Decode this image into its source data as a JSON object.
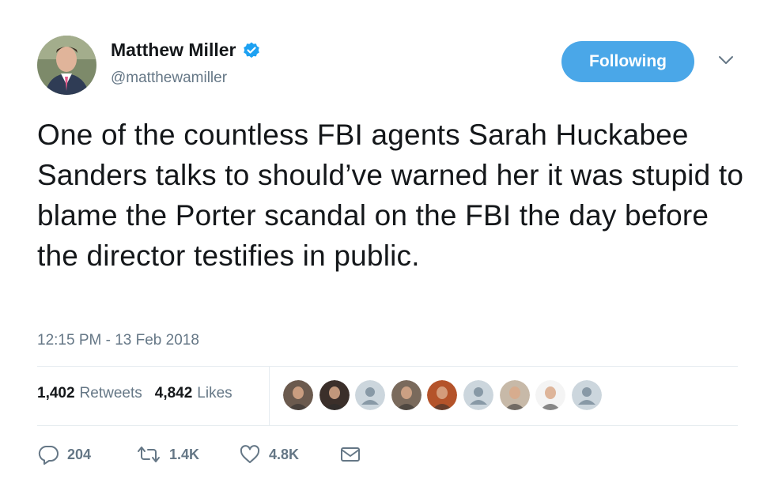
{
  "author": {
    "display_name": "Matthew Miller",
    "handle": "@matthewamiller",
    "verified": true
  },
  "follow_button": {
    "label": "Following"
  },
  "tweet": {
    "text": "One of the countless FBI agents Sarah Huckabee Sanders talks to should’ve warned her it was stupid to blame the Porter scandal on the FBI the day before the director testifies in public.",
    "timestamp": "12:15 PM - 13 Feb 2018"
  },
  "stats": {
    "retweets_count": "1,402",
    "retweets_label": "Retweets",
    "likes_count": "4,842",
    "likes_label": "Likes"
  },
  "likers": [
    {
      "type": "photo",
      "color": "#6b5a4e"
    },
    {
      "type": "photo",
      "color": "#3b2f2a"
    },
    {
      "type": "default",
      "color": "#ccd6dd"
    },
    {
      "type": "photo",
      "color": "#7a6a5c"
    },
    {
      "type": "photo",
      "color": "#b4532a"
    },
    {
      "type": "default",
      "color": "#ccd6dd"
    },
    {
      "type": "photo",
      "color": "#c7b9a8"
    },
    {
      "type": "photo",
      "color": "#f4f4f4"
    },
    {
      "type": "default",
      "color": "#ccd6dd"
    }
  ],
  "actions": {
    "reply_count": "204",
    "retweet_count": "1.4K",
    "like_count": "4.8K"
  },
  "colors": {
    "accent": "#1da1f2",
    "follow_button": "#4aa7e8",
    "secondary_text": "#657786",
    "divider": "#e6ecf0"
  },
  "icons": {
    "verified": "verified-badge-icon",
    "caret": "chevron-down-icon",
    "reply": "reply-icon",
    "retweet": "retweet-icon",
    "like": "heart-icon",
    "dm": "envelope-icon"
  }
}
